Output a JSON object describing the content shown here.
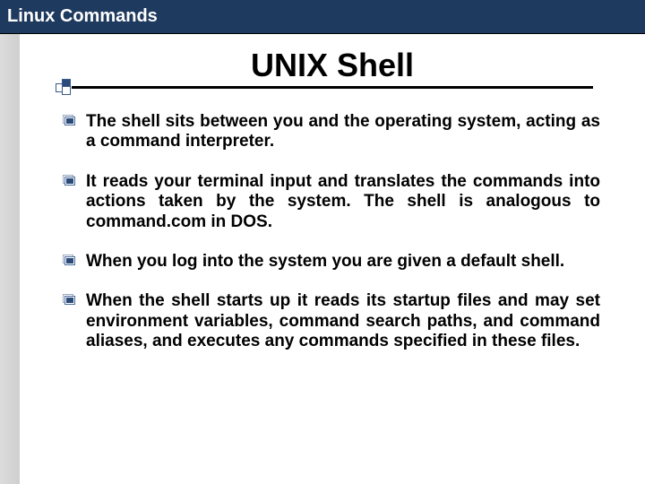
{
  "header": {
    "title": "Linux Commands"
  },
  "slide": {
    "title": "UNIX Shell",
    "bullets": [
      "The shell sits between you and the operating system, acting as a command interpreter.",
      "It reads your terminal input and translates the commands into actions taken by the system. The shell is analogous to command.com in DOS.",
      "When you log into the system you are given a default shell.",
      "When the shell starts up it reads its startup files and may set environment variables, command search paths, and command aliases, and executes any commands specified in these files."
    ]
  }
}
